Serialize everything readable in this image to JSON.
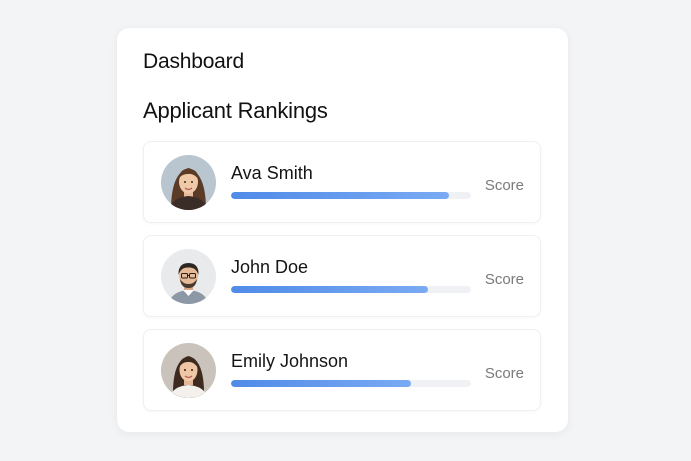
{
  "dashboard": {
    "title": "Dashboard",
    "section_title": "Applicant Rankings",
    "applicants": [
      {
        "name": "Ava Smith",
        "score_label": "Score",
        "score_fraction": 0.91
      },
      {
        "name": "John Doe",
        "score_label": "Score",
        "score_fraction": 0.82
      },
      {
        "name": "Emily Johnson",
        "score_label": "Score",
        "score_fraction": 0.75
      }
    ]
  },
  "colors": {
    "accent": "#4f8be8",
    "track": "#f0f1f4",
    "background": "#f3f4f6"
  }
}
